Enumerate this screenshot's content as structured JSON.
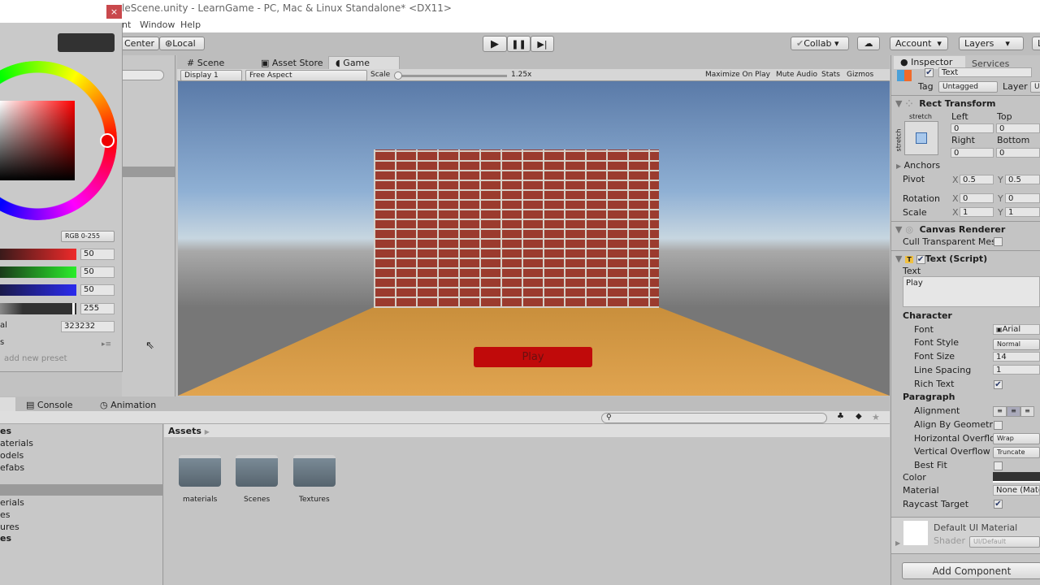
{
  "window": {
    "title": "leScene.unity - LearnGame - PC, Mac & Linux Standalone* <DX11>"
  },
  "menu": [
    "nt",
    "Window",
    "Help"
  ],
  "toolbar": {
    "center": "Center",
    "local": "Local",
    "collab": "Collab",
    "account": "Account",
    "layers": "Layers",
    "layout": "L"
  },
  "game_tabs": {
    "scene": "Scene",
    "asset_store": "Asset Store",
    "game": "Game"
  },
  "game_toolbar": {
    "display": "Display 1",
    "aspect": "Free Aspect",
    "scale_label": "Scale",
    "scale_value": "1.25x",
    "maximize": "Maximize On Play",
    "mute": "Mute Audio",
    "stats": "Stats",
    "gizmos": "Gizmos"
  },
  "game_view": {
    "button_text": "Play",
    "button_color": "#c00a0a"
  },
  "color_picker": {
    "close": "×",
    "current_color": "#323232",
    "mode": "RGB 0-255",
    "r": "50",
    "g": "50",
    "b": "50",
    "a": "255",
    "hex_label": "al",
    "hex": "323232",
    "presets_label": "s",
    "add_preset": "add new preset"
  },
  "bottom_tabs": {
    "console": "Console",
    "animation": "Animation"
  },
  "project_tree": [
    "es",
    "aterials",
    "odels",
    "efabs",
    "",
    "erials",
    "es",
    "ures",
    "es"
  ],
  "assets": {
    "breadcrumb": "Assets",
    "folders": [
      "materials",
      "Scenes",
      "Textures"
    ]
  },
  "inspector": {
    "tabs": {
      "inspector": "Inspector",
      "services": "Services"
    },
    "object_name": "Text",
    "tag_label": "Tag",
    "tag": "Untagged",
    "layer_label": "Layer",
    "layer": "U",
    "rect_transform": {
      "title": "Rect Transform",
      "stretch_h": "stretch",
      "stretch_v": "stretch",
      "left_label": "Left",
      "top_label": "Top",
      "left": "0",
      "top": "0",
      "right_label": "Right",
      "bottom_label": "Bottom",
      "right": "0",
      "bottom": "0",
      "anchors": "Anchors",
      "pivot_label": "Pivot",
      "pivot_x": "0.5",
      "pivot_y": "0.5",
      "rotation_label": "Rotation",
      "rot_x": "0",
      "rot_y": "0",
      "scale_label": "Scale",
      "scale_x": "1",
      "scale_y": "1",
      "x": "X",
      "y": "Y"
    },
    "canvas_renderer": {
      "title": "Canvas Renderer",
      "cull": "Cull Transparent Mes"
    },
    "text_script": {
      "title": "Text (Script)",
      "text_label": "Text",
      "text": "Play",
      "character": "Character",
      "font_label": "Font",
      "font": "Arial",
      "font_style_label": "Font Style",
      "font_style": "Normal",
      "font_size_label": "Font Size",
      "font_size": "14",
      "line_spacing_label": "Line Spacing",
      "line_spacing": "1",
      "rich_text_label": "Rich Text",
      "paragraph": "Paragraph",
      "alignment_label": "Alignment",
      "align_geom_label": "Align By Geometry",
      "h_overflow_label": "Horizontal Overflo",
      "h_overflow": "Wrap",
      "v_overflow_label": "Vertical Overflow",
      "v_overflow": "Truncate",
      "best_fit_label": "Best Fit",
      "color_label": "Color",
      "color": "#323232",
      "material_label": "Material",
      "material": "None (Mate",
      "raycast_label": "Raycast Target"
    },
    "material": {
      "name": "Default UI Material",
      "shader_label": "Shader",
      "shader": "UI/Default"
    },
    "add_component": "Add Component"
  }
}
